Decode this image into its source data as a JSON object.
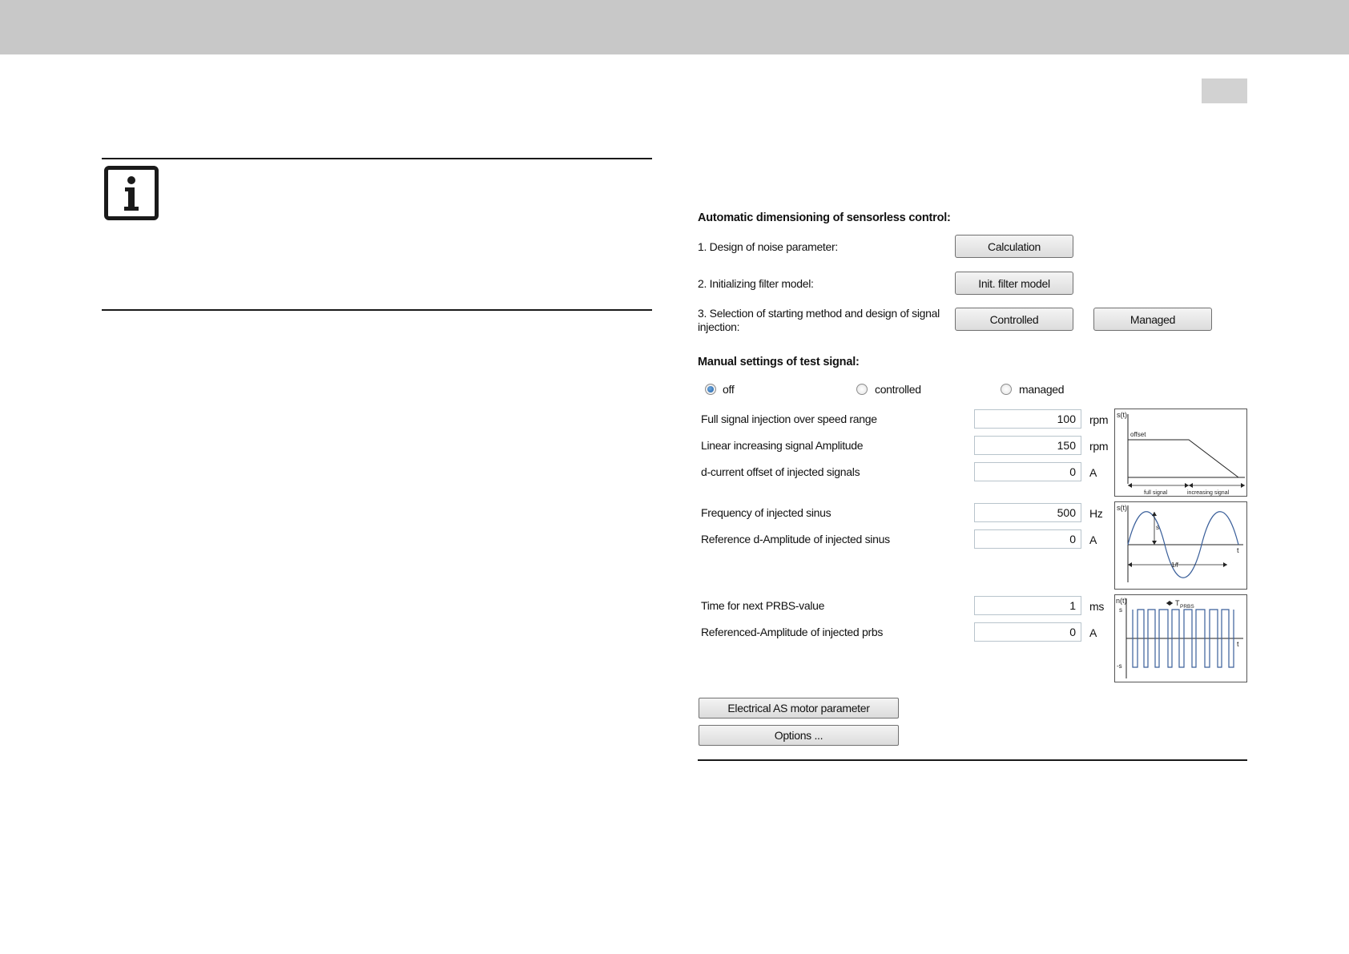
{
  "auto": {
    "heading": "Automatic dimensioning of sensorless control:",
    "step1_label": "1. Design of noise parameter:",
    "step1_button": "Calculation",
    "step2_label": "2. Initializing filter model:",
    "step2_button": "Init. filter model",
    "step3_label_line1": "3. Selection of starting method and design of signal",
    "step3_label_line2": "injection:",
    "step3_button_a": "Controlled",
    "step3_button_b": "Managed"
  },
  "manual": {
    "heading": "Manual settings of test signal:",
    "radios": [
      {
        "label": "off",
        "checked": true
      },
      {
        "label": "controlled",
        "checked": false
      },
      {
        "label": "managed",
        "checked": false
      }
    ],
    "params": [
      {
        "label": "Full signal injection over speed range",
        "value": "100",
        "unit": "rpm"
      },
      {
        "label": "Linear increasing signal Amplitude",
        "value": "150",
        "unit": "rpm"
      },
      {
        "label": "d-current offset of injected signals",
        "value": "0",
        "unit": "A"
      },
      {
        "label": "Frequency of injected sinus",
        "value": "500",
        "unit": "Hz"
      },
      {
        "label": "Reference d-Amplitude of injected sinus",
        "value": "0",
        "unit": "A"
      },
      {
        "label": "Time for next PRBS-value",
        "value": "1",
        "unit": "ms"
      },
      {
        "label": "Referenced-Amplitude of injected prbs",
        "value": "0",
        "unit": "A"
      }
    ]
  },
  "diagrams": {
    "offset": {
      "ylabel": "s(t)",
      "offset_label": "offset",
      "full_label": "full signal",
      "inc_label": "increasing signal"
    },
    "sinus": {
      "ylabel": "s(t)",
      "amp_label": "s",
      "t_label": "t",
      "period_label": "1/f"
    },
    "prbs": {
      "ylabel": "n(t)",
      "pos_label": "s",
      "neg_label": "-s",
      "t_label": "t",
      "period_label": "T",
      "period_sub": "PRBS"
    }
  },
  "bottom": {
    "motor_button": "Electrical AS motor parameter",
    "options_button": "Options ..."
  },
  "colors": {
    "topbar": "#c8c8c8",
    "radio_checked": "#1f5fa8",
    "prbs_line": "#3a5f9a"
  },
  "icons": {
    "note": "info-icon"
  }
}
